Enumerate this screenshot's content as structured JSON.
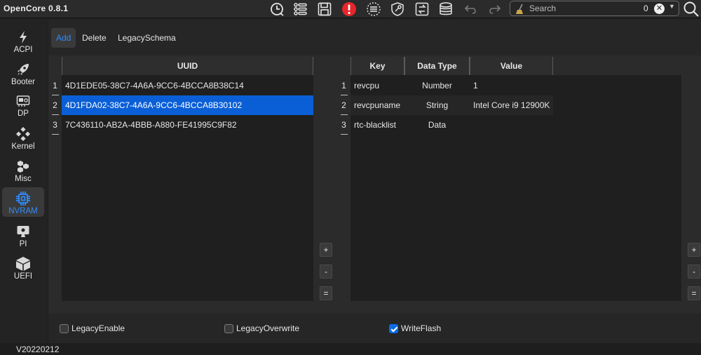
{
  "app": {
    "title": "OpenCore 0.8.1"
  },
  "toolbar": {
    "icons": [
      "clock-icon",
      "list-icon",
      "save-icon",
      "alert-icon",
      "text-list-icon",
      "shield-wrench-icon",
      "swap-icon",
      "database-icon",
      "undo-icon",
      "redo-icon"
    ],
    "alert_color": "#e5262b",
    "search": {
      "placeholder": "Search",
      "count": "0"
    }
  },
  "sidebar": {
    "items": [
      {
        "label": "ACPI",
        "icon": "lightning-icon"
      },
      {
        "label": "Booter",
        "icon": "rocket-icon"
      },
      {
        "label": "DP",
        "icon": "device-icon"
      },
      {
        "label": "Kernel",
        "icon": "puzzle-icon"
      },
      {
        "label": "Misc",
        "icon": "cubes-icon"
      },
      {
        "label": "NVRAM",
        "icon": "chip-icon",
        "active": true
      },
      {
        "label": "PI",
        "icon": "computer-icon"
      },
      {
        "label": "UEFI",
        "icon": "box-icon"
      }
    ],
    "accent": "#2f8cff"
  },
  "subtabs": [
    "Add",
    "Delete",
    "LegacySchema"
  ],
  "left_table": {
    "header": "UUID",
    "rows": [
      {
        "num": "1",
        "uuid": "4D1EDE05-38C7-4A6A-9CC6-4BCCA8B38C14"
      },
      {
        "num": "2",
        "uuid": "4D1FDA02-38C7-4A6A-9CC6-4BCCA8B30102",
        "selected": true
      },
      {
        "num": "3",
        "uuid": "7C436110-AB2A-4BBB-A880-FE41995C9F82"
      }
    ]
  },
  "right_table": {
    "headers": [
      "Key",
      "Data Type",
      "Value"
    ],
    "rows": [
      {
        "num": "1",
        "key": "revcpu",
        "type": "Number",
        "value": "1"
      },
      {
        "num": "2",
        "key": "revcpuname",
        "type": "String",
        "value": "Intel Core i9 12900K"
      },
      {
        "num": "3",
        "key": "rtc-blacklist",
        "type": "Data",
        "value": ""
      }
    ]
  },
  "buttons": {
    "add": "+",
    "remove": "-",
    "equal": "="
  },
  "options": [
    {
      "label": "LegacyEnable",
      "checked": false
    },
    {
      "label": "LegacyOverwrite",
      "checked": false
    },
    {
      "label": "WriteFlash",
      "checked": true
    }
  ],
  "status": {
    "version": "V20220212"
  },
  "colors": {
    "selection": "#0a5fd6",
    "checkbox_on": "#0a6ce8"
  }
}
